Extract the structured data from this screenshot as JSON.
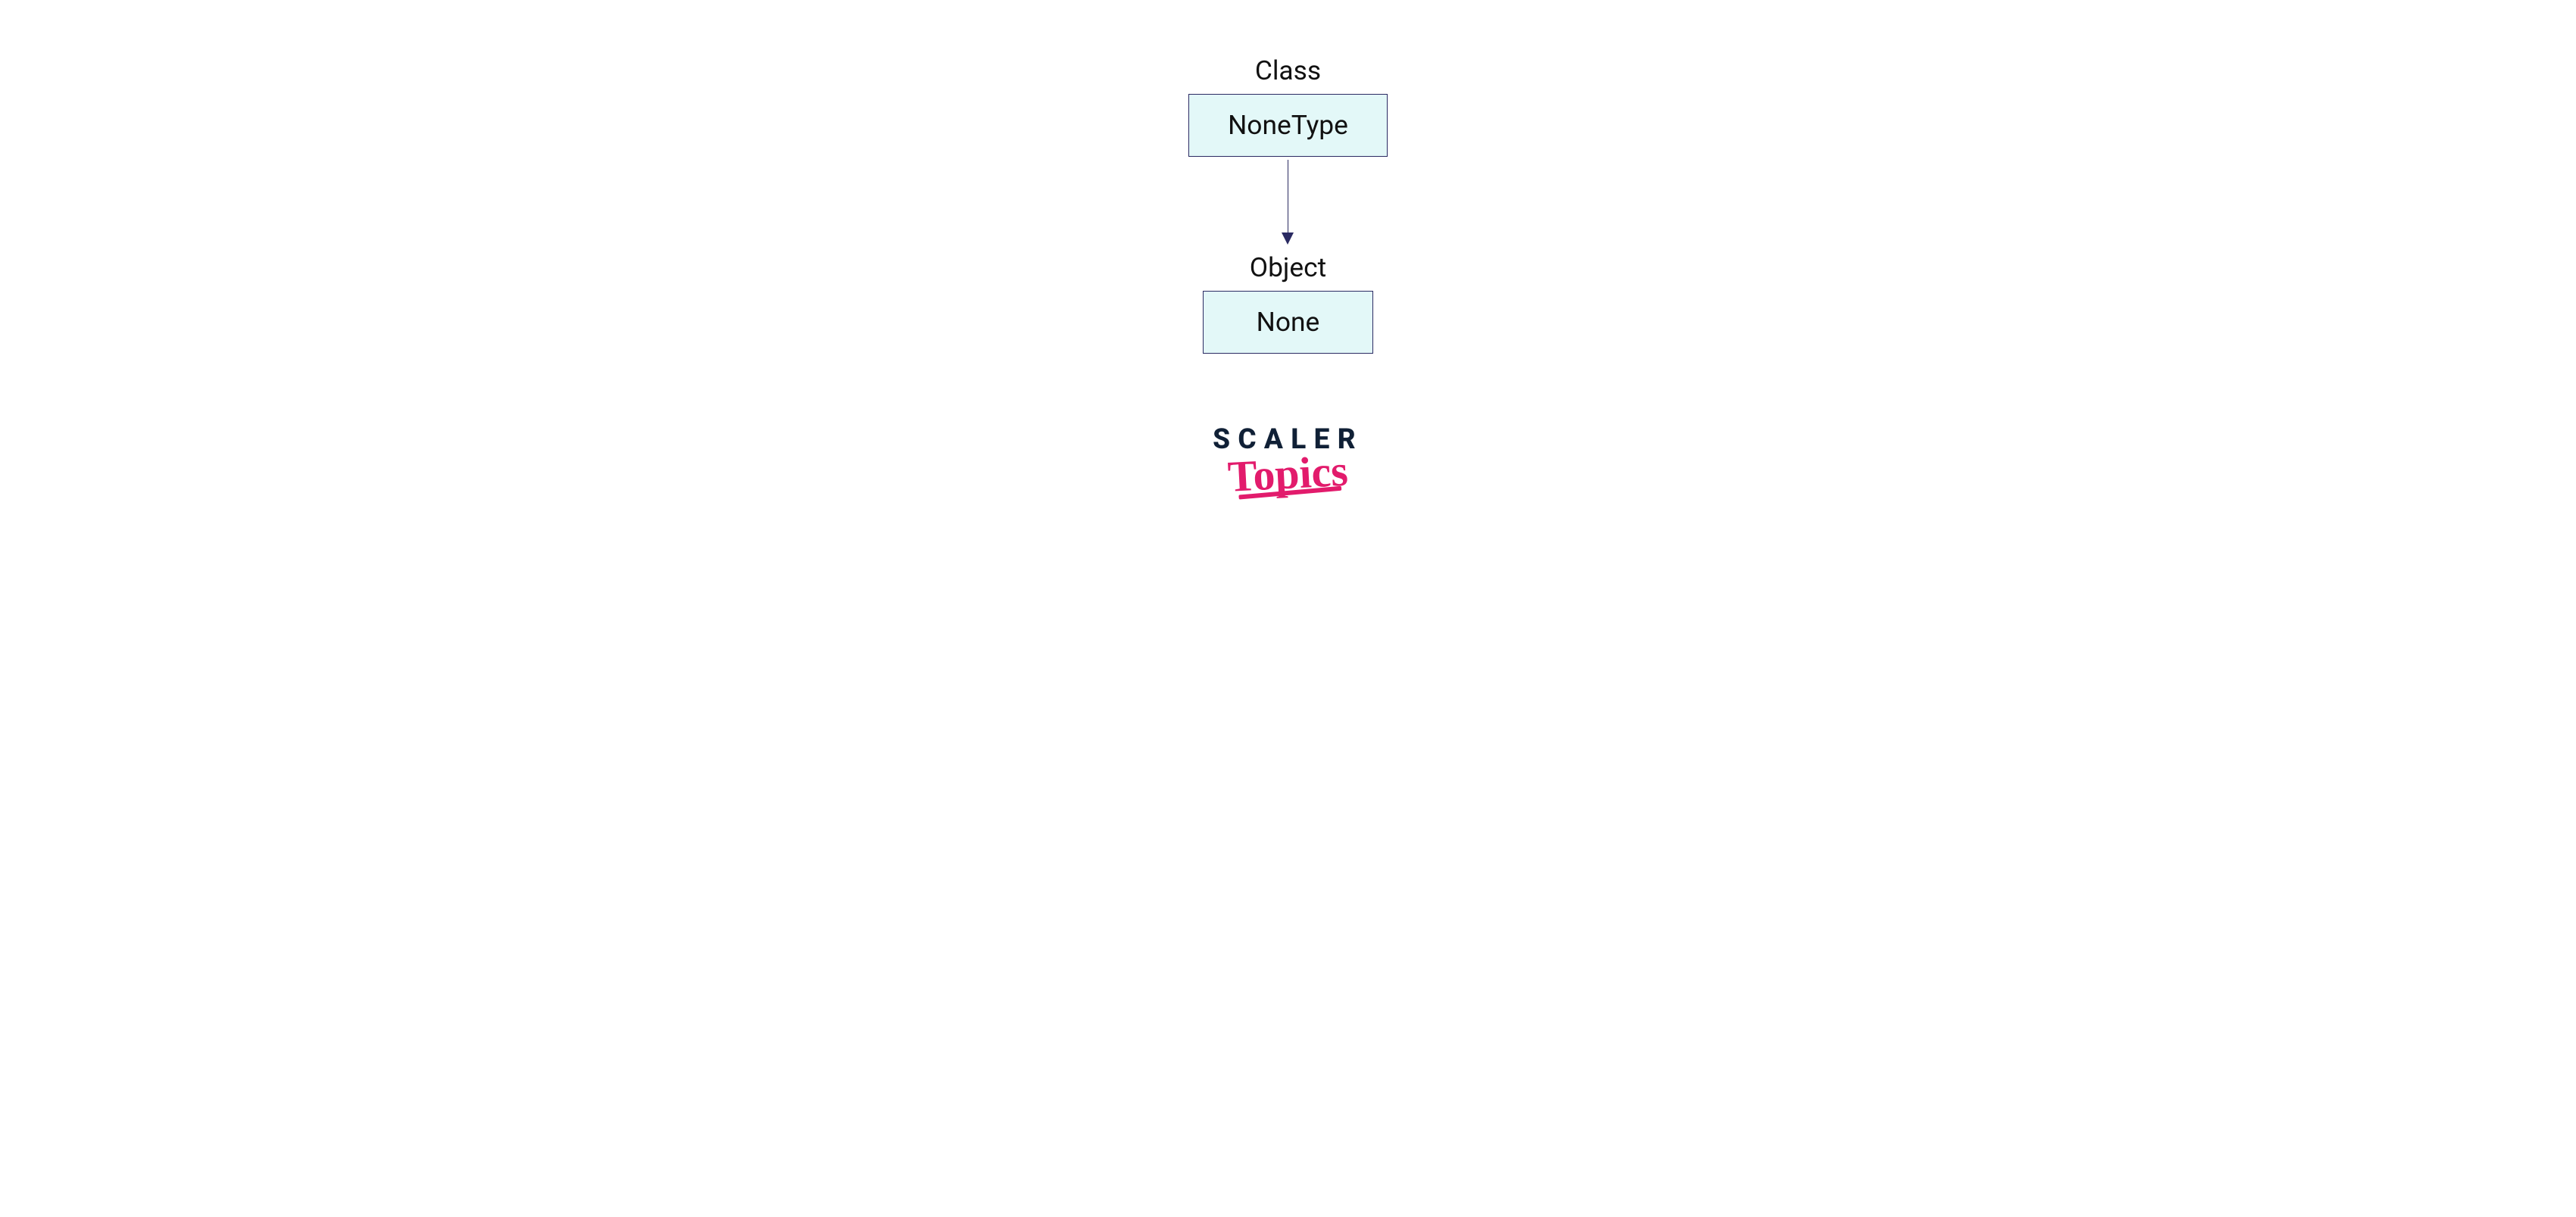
{
  "diagram": {
    "topLabel": "Class",
    "topBox": "NoneType",
    "bottomLabel": "Object",
    "bottomBox": "None"
  },
  "brand": {
    "line1": "SCALER",
    "line2": "Topics"
  }
}
